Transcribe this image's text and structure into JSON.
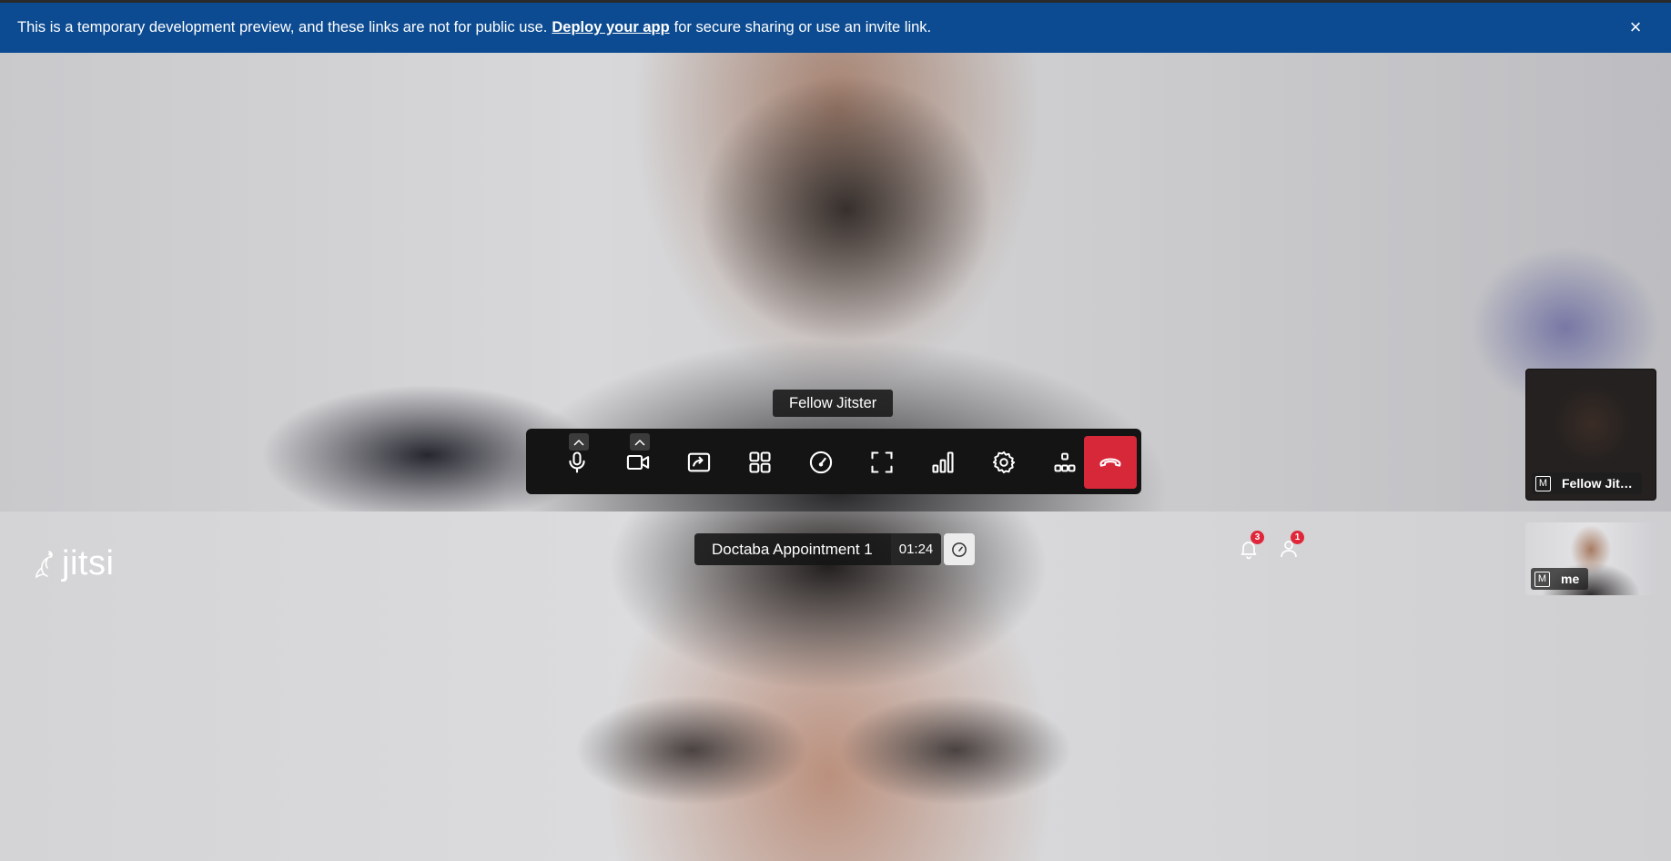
{
  "banner": {
    "text_before": "This is a temporary development preview, and these links are not for public use.",
    "link": "Deploy your app",
    "text_after": "for secure sharing or use an invite link.",
    "close_icon": "close-icon"
  },
  "stage": {
    "tooltip_name": "Fellow Jitster"
  },
  "toolbar": {
    "buttons": [
      {
        "name": "microphone",
        "icon": "microphone-icon"
      },
      {
        "name": "camera",
        "icon": "camera-icon"
      },
      {
        "name": "share-screen",
        "icon": "share-screen-icon"
      },
      {
        "name": "tile-view",
        "icon": "tile-view-icon"
      },
      {
        "name": "performance-settings",
        "icon": "speedometer-icon"
      },
      {
        "name": "fullscreen",
        "icon": "fullscreen-icon"
      },
      {
        "name": "connection-stats",
        "icon": "signal-bars-icon"
      },
      {
        "name": "settings",
        "icon": "gear-icon"
      },
      {
        "name": "more",
        "icon": "more-icon"
      },
      {
        "name": "hangup",
        "icon": "hangup-icon"
      }
    ],
    "hangup_color": "#d7283a"
  },
  "logo": {
    "text": "jitsi"
  },
  "meeting": {
    "subject": "Doctaba Appointment 1",
    "timer": "01:24"
  },
  "indicators": {
    "notifications_count": "3",
    "participants_count": "1"
  },
  "thumbnails": [
    {
      "name": "Fellow Jitster",
      "display": "Fellow Jit…",
      "muted_icon": "M"
    },
    {
      "name": "me",
      "display": "me",
      "muted_icon": "M"
    }
  ],
  "colors": {
    "banner_bg": "#0c4b91",
    "toolbar_bg": "#141414",
    "badge": "#e0273a"
  }
}
